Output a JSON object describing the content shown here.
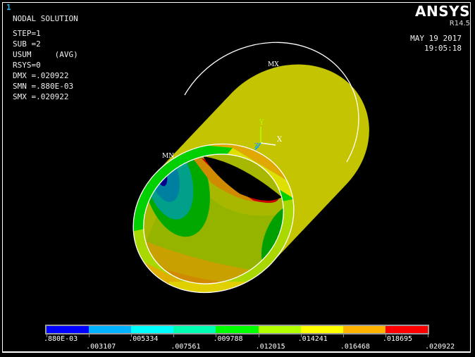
{
  "window_number": "1",
  "brand": "ANSYS",
  "version": "R14.5",
  "date": "MAY 19 2017",
  "time": "19:05:18",
  "info": {
    "title": "NODAL SOLUTION",
    "lines": [
      "STEP=1",
      "SUB =2",
      "USUM     (AVG)",
      "RSYS=0",
      "DMX =.020922",
      "SMN =.880E-03",
      "SMX =.020922"
    ]
  },
  "model": {
    "max_label": "MX",
    "min_label": "MN",
    "triad": {
      "x": "X",
      "y": "Y",
      "z": "Z"
    }
  },
  "legend": {
    "colors": [
      "#0000ff",
      "#00b2ff",
      "#00ffff",
      "#00ffb2",
      "#00ff00",
      "#b2ff00",
      "#ffff00",
      "#ffb200",
      "#ff0000"
    ],
    "labels": [
      ".880E-03",
      ".003107",
      ".005334",
      ".007561",
      ".009788",
      ".012015",
      ".014241",
      ".016468",
      ".018695",
      ".020922"
    ]
  }
}
